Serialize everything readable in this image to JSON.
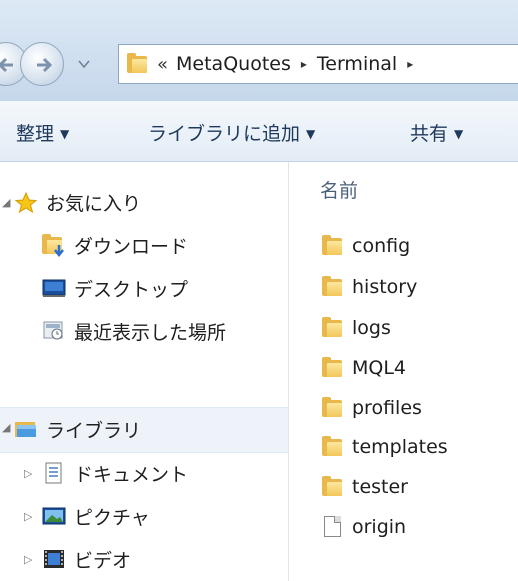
{
  "address": {
    "overflow": "«",
    "crumbs": [
      "MetaQuotes",
      "Terminal"
    ],
    "separator": "▸"
  },
  "toolbar": {
    "organize": "整理",
    "add_to_library": "ライブラリに追加",
    "share": "共有",
    "caret": "▼"
  },
  "nav": {
    "favorites": "お気に入り",
    "downloads": "ダウンロード",
    "desktop": "デスクトップ",
    "recent": "最近表示した場所",
    "libraries": "ライブラリ",
    "documents": "ドキュメント",
    "pictures": "ピクチャ",
    "videos": "ビデオ"
  },
  "content": {
    "column_name": "名前",
    "items": [
      {
        "name": "config",
        "type": "folder"
      },
      {
        "name": "history",
        "type": "folder"
      },
      {
        "name": "logs",
        "type": "folder"
      },
      {
        "name": "MQL4",
        "type": "folder"
      },
      {
        "name": "profiles",
        "type": "folder"
      },
      {
        "name": "templates",
        "type": "folder"
      },
      {
        "name": "tester",
        "type": "folder"
      },
      {
        "name": "origin",
        "type": "file"
      }
    ]
  }
}
